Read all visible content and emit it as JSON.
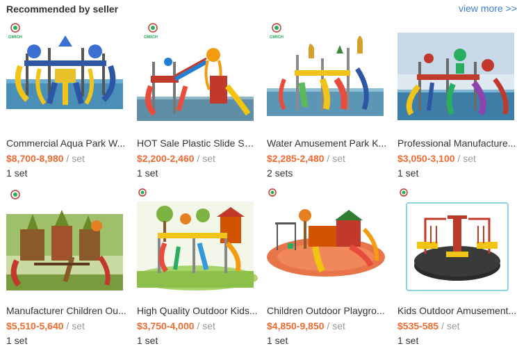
{
  "header": {
    "title": "Recommended by seller",
    "view_more": "view more >>"
  },
  "logo_text": "GMICH",
  "products": [
    {
      "title": "Commercial Aqua Park W...",
      "price": "$8,700-8,980",
      "unit": " / set",
      "moq": "1 set"
    },
    {
      "title": "HOT Sale Plastic Slide Set...",
      "price": "$2,200-2,460",
      "unit": " / set",
      "moq": "1 set"
    },
    {
      "title": "Water Amusement Park K...",
      "price": "$2,285-2,480",
      "unit": " / set",
      "moq": "2 sets"
    },
    {
      "title": "Professional Manufacture...",
      "price": "$3,050-3,100",
      "unit": " / set",
      "moq": "1 set"
    },
    {
      "title": "Manufacturer Children Ou...",
      "price": "$5,510-5,640",
      "unit": " / set",
      "moq": "1 set"
    },
    {
      "title": "High Quality Outdoor Kids...",
      "price": "$3,750-4,000",
      "unit": " / set",
      "moq": "1 set"
    },
    {
      "title": "Children Outdoor Playgro...",
      "price": "$4,850-9,850",
      "unit": " / set",
      "moq": "1 set"
    },
    {
      "title": "Kids Outdoor Amusement...",
      "price": "$535-585",
      "unit": " / set",
      "moq": "1 set"
    }
  ],
  "colors": {
    "price": "#f06a30",
    "link": "#3b7fd9"
  }
}
